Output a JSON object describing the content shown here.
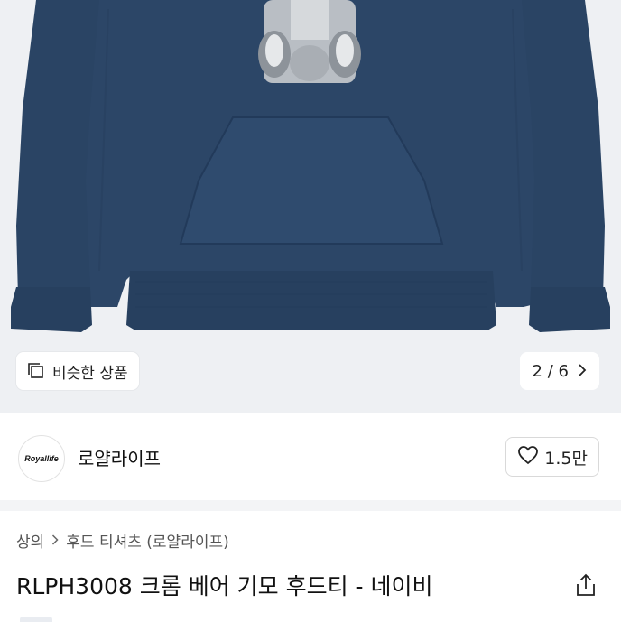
{
  "hero": {
    "similar_products_label": "비슷한 상품",
    "pager": {
      "current": "2",
      "separator": "/",
      "total": "6"
    }
  },
  "seller": {
    "logo_text": "Royallife",
    "name": "로얄라이프",
    "likes": "1.5만"
  },
  "breadcrumb": {
    "items": [
      "상의",
      "후드 티셔츠 (로얄라이프)"
    ]
  },
  "product": {
    "title": "RLPH3008 크롬 베어 기모 후드티 - 네이비"
  },
  "colors": {
    "hoodie": "#2c4667",
    "hero_bg": "#eef0f3",
    "divider": "#f3f4f6"
  }
}
